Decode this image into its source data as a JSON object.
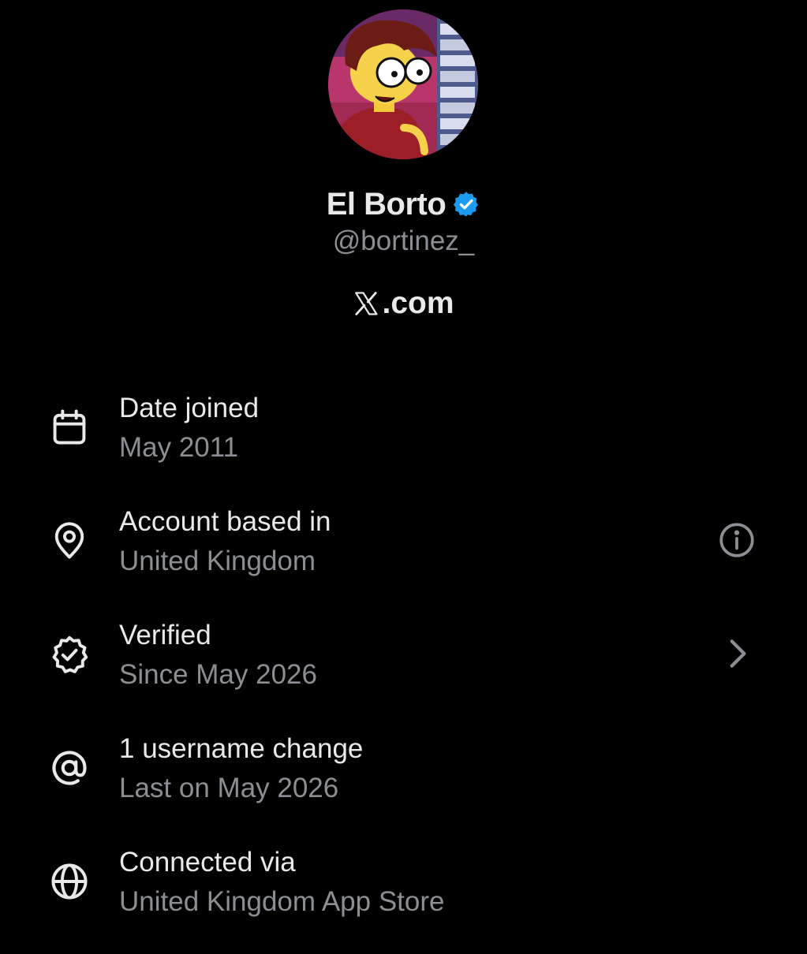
{
  "profile": {
    "display_name": "El Borto",
    "handle": "@bortinez_",
    "site_label": ".com",
    "verified_color": "#1d9bf0"
  },
  "details": [
    {
      "title": "Date joined",
      "value": "May 2011",
      "icon": "calendar-icon"
    },
    {
      "title": "Account based in",
      "value": "United Kingdom",
      "icon": "location-pin-icon",
      "action_icon": "info-icon"
    },
    {
      "title": "Verified",
      "value": "Since May 2026",
      "icon": "verified-badge-outline-icon",
      "action_icon": "chevron-right-icon"
    },
    {
      "title": "1 username change",
      "value": "Last on May 2026",
      "icon": "at-sign-icon"
    },
    {
      "title": "Connected via",
      "value": "United Kingdom App Store",
      "icon": "globe-icon"
    }
  ],
  "colors": {
    "background": "#000000",
    "primary_text": "#e7e9ea",
    "secondary_text": "#8b8f94",
    "accent": "#1d9bf0"
  }
}
